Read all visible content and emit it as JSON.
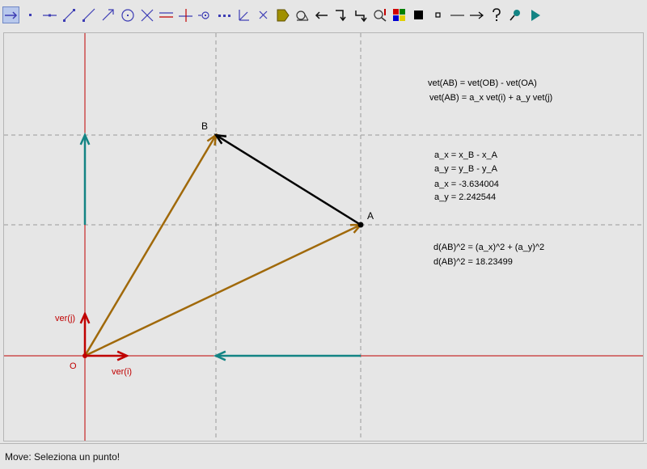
{
  "toolbar": {
    "tools": [
      {
        "id": "move",
        "icon": "move-arrow-icon",
        "active": true
      },
      {
        "id": "point",
        "icon": "point-icon"
      },
      {
        "id": "line",
        "icon": "line-icon"
      },
      {
        "id": "segment",
        "icon": "segment-icon"
      },
      {
        "id": "ray",
        "icon": "ray-icon"
      },
      {
        "id": "vector",
        "icon": "vector-icon"
      },
      {
        "id": "circle",
        "icon": "circle-icon"
      },
      {
        "id": "intersection",
        "icon": "intersection-icon"
      },
      {
        "id": "parallel",
        "icon": "parallel-line-icon"
      },
      {
        "id": "perpendicular",
        "icon": "perpendicular-line-icon"
      },
      {
        "id": "midpoint",
        "icon": "midpoint-icon"
      },
      {
        "id": "points-on-line",
        "icon": "dotted-line-icon"
      },
      {
        "id": "angle",
        "icon": "angle-icon"
      },
      {
        "id": "delete",
        "icon": "delete-x-icon"
      },
      {
        "id": "label",
        "icon": "label-tag-icon"
      },
      {
        "id": "measure",
        "icon": "measure-icon"
      },
      {
        "id": "undo",
        "icon": "undo-arrow-icon"
      },
      {
        "id": "redo",
        "icon": "redo-arrow-icon"
      },
      {
        "id": "refresh",
        "icon": "refresh-arrow-icon"
      },
      {
        "id": "zoom",
        "icon": "zoom-icon"
      },
      {
        "id": "colors",
        "icon": "color-palette-icon"
      },
      {
        "id": "fill",
        "icon": "filled-square-icon"
      },
      {
        "id": "small-point",
        "icon": "small-square-icon"
      },
      {
        "id": "thin-line",
        "icon": "thin-line-icon"
      },
      {
        "id": "arrow-line",
        "icon": "arrow-line-icon"
      },
      {
        "id": "help",
        "icon": "help-question-icon"
      },
      {
        "id": "pin",
        "icon": "pin-icon"
      },
      {
        "id": "play",
        "icon": "play-icon"
      }
    ]
  },
  "colors": {
    "axis": "#c00000",
    "grid": "#9a9a9a",
    "vec_gold": "#a0690a",
    "vec_teal": "#138484",
    "vec_black": "#000000",
    "text": "#000000",
    "accent": "#3c3cb4"
  },
  "labels": {
    "point_a": "A",
    "point_b": "B",
    "point_o": "O",
    "ver_i": "ver(i)",
    "ver_j": "ver(j)"
  },
  "equations": {
    "eq1": "vet(AB) = vet(OB) - vet(OA)",
    "eq2": "vet(AB) = a_x vet(i) + a_y vet(j)",
    "eq3": "a_x = x_B - x_A",
    "eq4": "a_y = y_B - y_A",
    "eq5": "a_x = -3.634004",
    "eq6": "a_y = 2.242544",
    "eq7": "d(AB)^2 = (a_x)^2 + (a_y)^2",
    "eq8": "d(AB)^2 = 18.23499"
  },
  "status": {
    "text": "Move: Seleziona un punto!"
  }
}
